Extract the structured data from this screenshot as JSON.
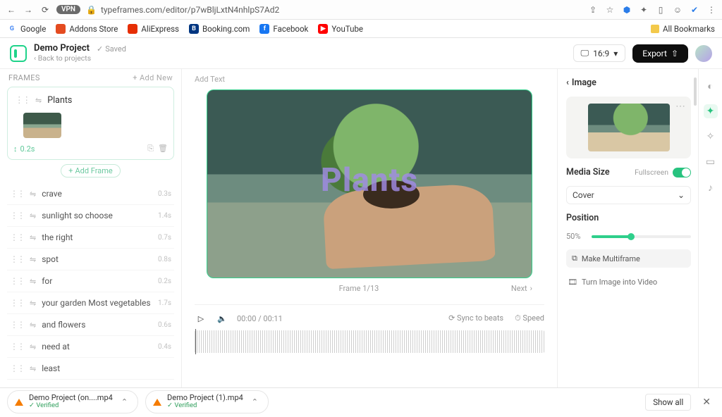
{
  "browser": {
    "url": "typeframes.com/editor/p7wBljLxtN4nhlpS7Ad2",
    "vpn": "VPN",
    "all_bookmarks": "All Bookmarks"
  },
  "bookmarks": [
    {
      "label": "Google",
      "color": "#fff",
      "txt": "G",
      "text_color": "#4285F4"
    },
    {
      "label": "Addons Store",
      "color": "#e44b20"
    },
    {
      "label": "AliExpress",
      "color": "#e62e04"
    },
    {
      "label": "Booking.com",
      "color": "#003580",
      "txt": "B"
    },
    {
      "label": "Facebook",
      "color": "#1877f2",
      "txt": "f"
    },
    {
      "label": "YouTube",
      "color": "#ff0000",
      "txt": "▶"
    }
  ],
  "header": {
    "project_title": "Demo Project",
    "saved": "Saved",
    "back": "Back to projects",
    "ratio": "16:9",
    "export": "Export"
  },
  "frames": {
    "title": "FRAMES",
    "add_new": "Add New",
    "add_frame": "Add Frame",
    "active": {
      "title": "Plants",
      "duration": "0.2s"
    },
    "list": [
      {
        "text": "crave",
        "dur": "0.3s"
      },
      {
        "text": "sunlight so choose",
        "dur": "1.4s"
      },
      {
        "text": "the right",
        "dur": "0.7s"
      },
      {
        "text": "spot",
        "dur": "0.8s"
      },
      {
        "text": "for",
        "dur": "0.2s"
      },
      {
        "text": "your garden Most vegetables",
        "dur": "1.7s"
      },
      {
        "text": "and flowers",
        "dur": "0.6s"
      },
      {
        "text": "need at",
        "dur": "0.4s"
      },
      {
        "text": "least",
        "dur": ""
      }
    ]
  },
  "canvas": {
    "add_text": "Add Text",
    "overlay": "Plants",
    "frame_count": "Frame 1/13",
    "next": "Next"
  },
  "player": {
    "time": "00:00 / 00:11",
    "sync": "Sync to beats",
    "speed": "Speed"
  },
  "right": {
    "back": "Image",
    "media_size": "Media Size",
    "fullscreen": "Fullscreen",
    "cover": "Cover",
    "position": "Position",
    "pos_val": "50%",
    "make_multi": "Make Multiframe",
    "turn_video": "Turn Image into Video"
  },
  "downloads": {
    "items": [
      {
        "name": "Demo Project (on....mp4",
        "status": "Verified"
      },
      {
        "name": "Demo Project (1).mp4",
        "status": "Verified"
      }
    ],
    "show_all": "Show all"
  }
}
